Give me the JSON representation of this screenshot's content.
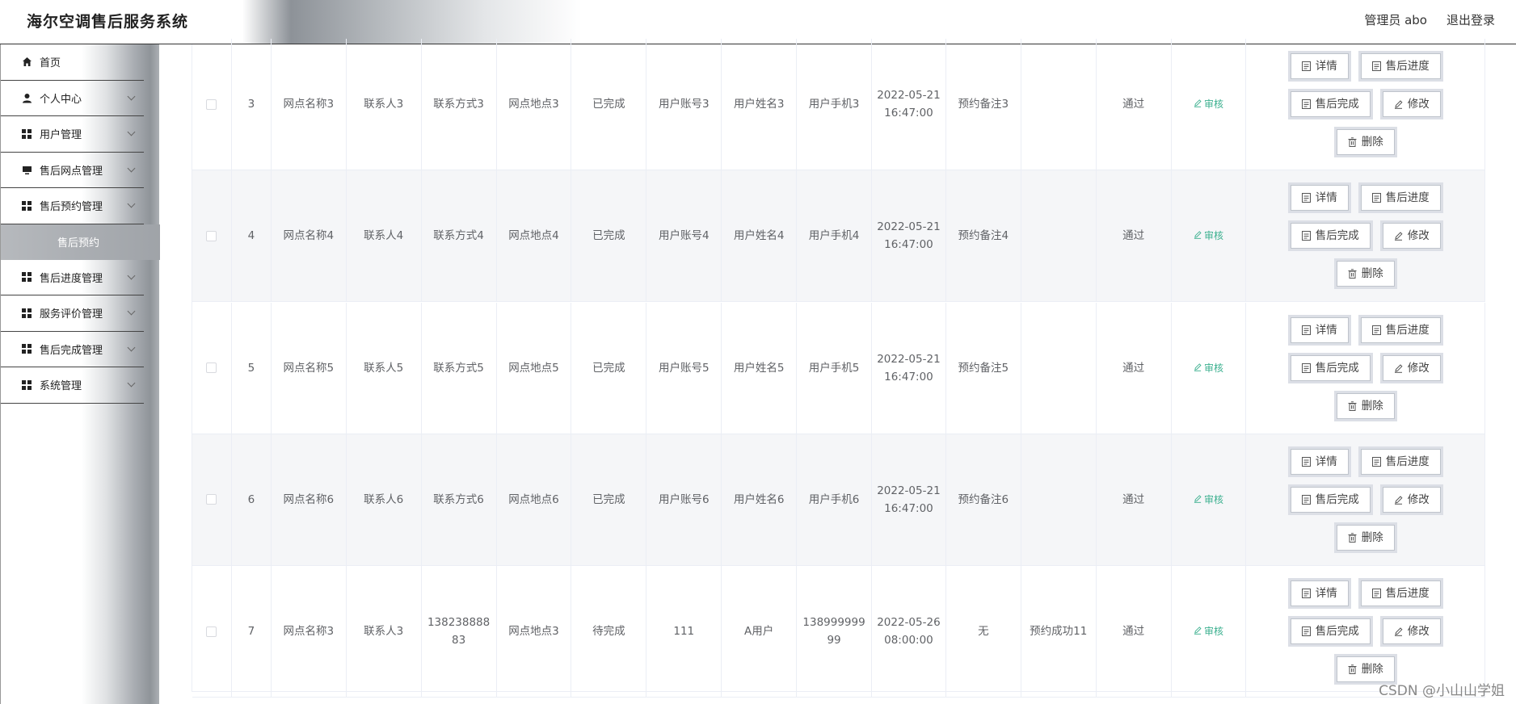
{
  "header": {
    "app_title": "海尔空调售后服务系统",
    "user_label": "管理员 abo",
    "logout_label": "退出登录"
  },
  "sidebar": {
    "items": [
      {
        "label": "首页",
        "icon": "home-icon",
        "chevron": false
      },
      {
        "label": "个人中心",
        "icon": "user-icon",
        "chevron": true
      },
      {
        "label": "用户管理",
        "icon": "grid-icon",
        "chevron": true
      },
      {
        "label": "售后网点管理",
        "icon": "monitor-icon",
        "chevron": true
      },
      {
        "label": "售后预约管理",
        "icon": "grid-icon",
        "chevron": true,
        "expanded": true
      },
      {
        "label": "售后预约",
        "sub": true,
        "active": true
      },
      {
        "label": "售后进度管理",
        "icon": "grid-icon",
        "chevron": true
      },
      {
        "label": "服务评价管理",
        "icon": "grid-icon",
        "chevron": true
      },
      {
        "label": "售后完成管理",
        "icon": "grid-icon",
        "chevron": true
      },
      {
        "label": "系统管理",
        "icon": "grid-icon",
        "chevron": true
      }
    ]
  },
  "table": {
    "review_label": "审核",
    "buttons": {
      "detail": "详情",
      "progress": "售后进度",
      "complete": "售后完成",
      "edit": "修改",
      "delete": "删除"
    },
    "rows": [
      {
        "idx": "3",
        "outlet": "网点名称3",
        "contact": "联系人3",
        "contact_info": "联系方式3",
        "location": "网点地点3",
        "status": "已完成",
        "account": "用户账号3",
        "username": "用户姓名3",
        "phone": "用户手机3",
        "time": "2022-05-21 16:47:00",
        "remark": "预约备注3",
        "reply": "",
        "audit": "通过"
      },
      {
        "idx": "4",
        "outlet": "网点名称4",
        "contact": "联系人4",
        "contact_info": "联系方式4",
        "location": "网点地点4",
        "status": "已完成",
        "account": "用户账号4",
        "username": "用户姓名4",
        "phone": "用户手机4",
        "time": "2022-05-21 16:47:00",
        "remark": "预约备注4",
        "reply": "",
        "audit": "通过"
      },
      {
        "idx": "5",
        "outlet": "网点名称5",
        "contact": "联系人5",
        "contact_info": "联系方式5",
        "location": "网点地点5",
        "status": "已完成",
        "account": "用户账号5",
        "username": "用户姓名5",
        "phone": "用户手机5",
        "time": "2022-05-21 16:47:00",
        "remark": "预约备注5",
        "reply": "",
        "audit": "通过"
      },
      {
        "idx": "6",
        "outlet": "网点名称6",
        "contact": "联系人6",
        "contact_info": "联系方式6",
        "location": "网点地点6",
        "status": "已完成",
        "account": "用户账号6",
        "username": "用户姓名6",
        "phone": "用户手机6",
        "time": "2022-05-21 16:47:00",
        "remark": "预约备注6",
        "reply": "",
        "audit": "通过"
      },
      {
        "idx": "7",
        "outlet": "网点名称3",
        "contact": "联系人3",
        "contact_info": "13823888883",
        "location": "网点地点3",
        "status": "待完成",
        "account": "111",
        "username": "A用户",
        "phone": "13899999999",
        "time": "2022-05-26 08:00:00",
        "remark": "无",
        "reply": "预约成功11",
        "audit": "通过"
      }
    ]
  },
  "watermark": "CSDN @小山山学姐",
  "colors": {
    "accent": "#3cb08f",
    "border": "#ebeef5",
    "alt_row": "#f5f6f8"
  }
}
